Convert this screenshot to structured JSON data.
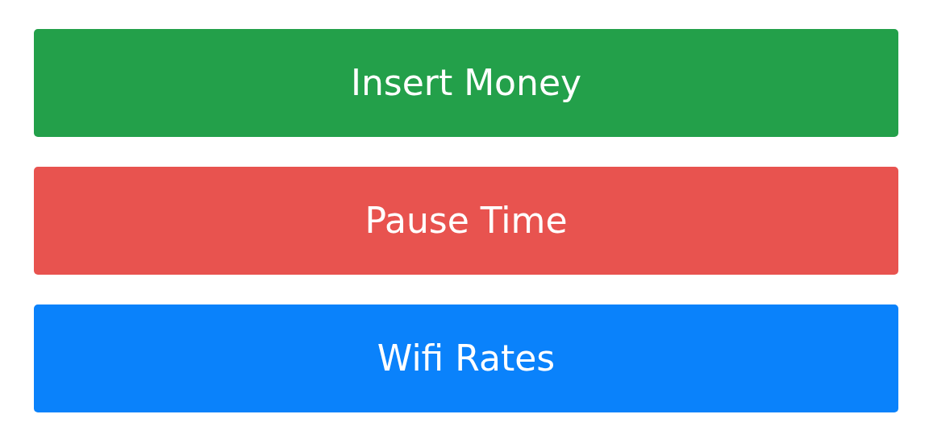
{
  "buttons": [
    {
      "label": "Insert Money",
      "color": "#23a04a"
    },
    {
      "label": "Pause Time",
      "color": "#e8534f"
    },
    {
      "label": "Wifi Rates",
      "color": "#0a82fb"
    }
  ]
}
